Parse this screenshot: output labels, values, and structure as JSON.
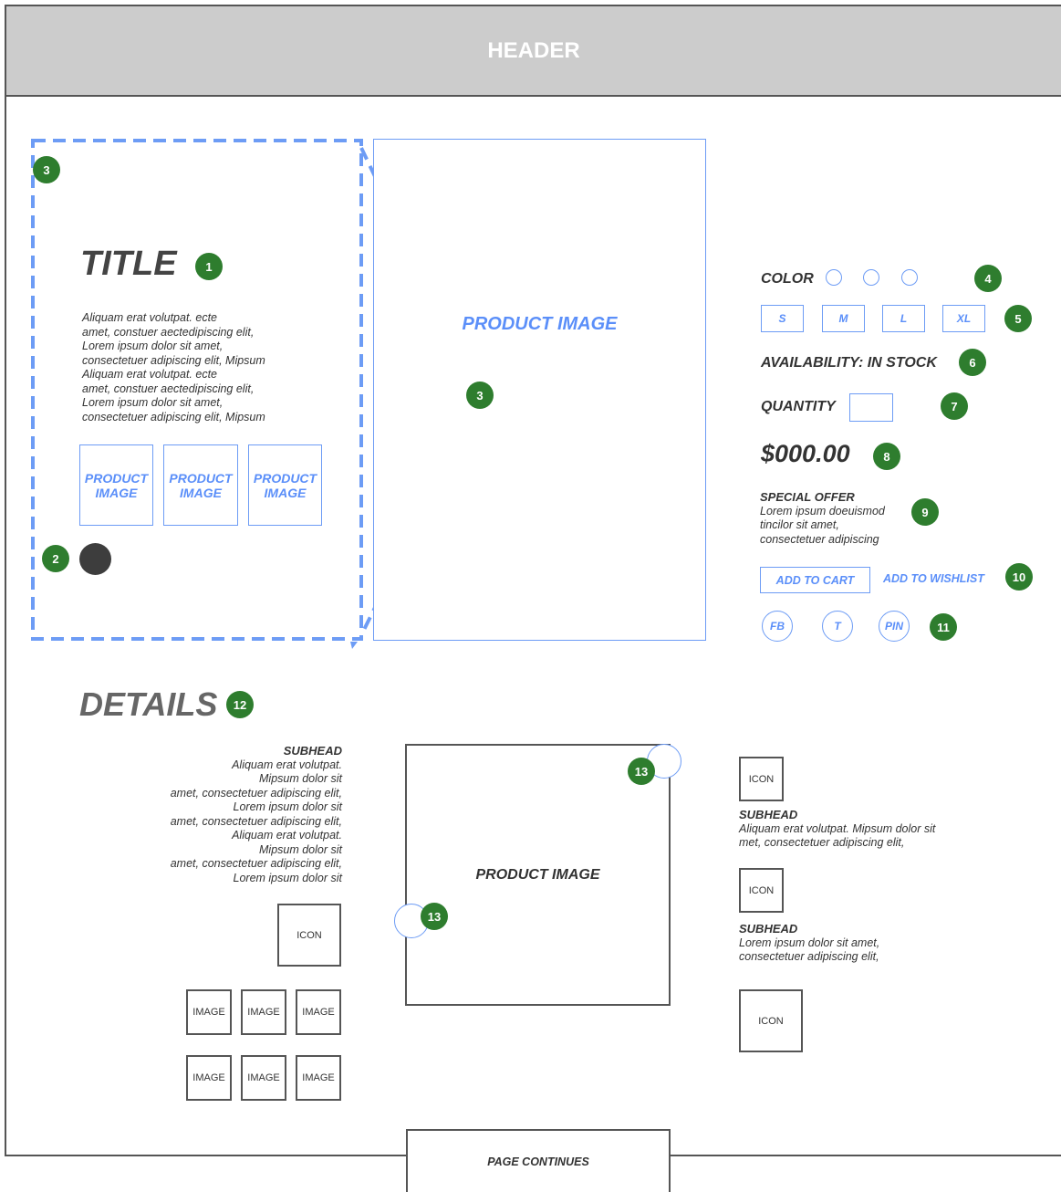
{
  "header": {
    "label": "HEADER"
  },
  "product": {
    "title": "TITLE",
    "description": [
      "Aliquam erat volutpat. ecte",
      "amet, constuer aectedipiscing elit,",
      "Lorem ipsum dolor sit amet,",
      "consectetuer adipiscing elit, Mipsum",
      "Aliquam erat volutpat. ecte",
      "amet, constuer aectedipiscing elit,",
      "Lorem ipsum dolor sit amet,",
      "consectetuer adipiscing elit, Mipsum"
    ],
    "thumbnails": [
      "PRODUCT IMAGE",
      "PRODUCT IMAGE",
      "PRODUCT IMAGE"
    ],
    "main_image": "PRODUCT IMAGE"
  },
  "options": {
    "color_label": "COLOR",
    "sizes": [
      "S",
      "M",
      "L",
      "XL"
    ],
    "availability": "AVAILABILITY: IN STOCK",
    "quantity_label": "QUANTITY",
    "price": "$000.00",
    "special_offer_title": "SPECIAL OFFER",
    "special_offer_text": [
      "Lorem ipsum doeuismod",
      "tincilor sit amet,",
      "consectetuer adipiscing"
    ],
    "add_to_cart": "ADD TO CART",
    "add_to_wishlist": "ADD TO WISHLIST",
    "social": [
      "FB",
      "T",
      "PIN"
    ]
  },
  "details": {
    "title": "DETAILS",
    "left_subhead": "SUBHEAD",
    "left_text": [
      "Aliquam erat volutpat.",
      "Mipsum dolor sit",
      "amet, consectetuer adipiscing elit,",
      "Lorem ipsum dolor sit",
      "amet, consectetuer adipiscing elit,",
      "Aliquam erat volutpat.",
      "Mipsum dolor sit",
      "amet, consectetuer adipiscing elit,",
      "Lorem ipsum dolor sit"
    ],
    "icon_label": "ICON",
    "image_label": "IMAGE",
    "center_image": "PRODUCT IMAGE",
    "right_items": [
      {
        "icon": "ICON",
        "subhead": "SUBHEAD",
        "text": [
          "Aliquam erat volutpat. Mipsum dolor sit",
          "met, consectetuer adipiscing elit,"
        ]
      },
      {
        "icon": "ICON",
        "subhead": "SUBHEAD",
        "text": [
          "Lorem ipsum dolor sit amet,",
          "consectetuer adipiscing elit,"
        ]
      },
      {
        "icon": "ICON"
      }
    ]
  },
  "footer": {
    "label": "PAGE CONTINUES"
  },
  "badges": [
    "1",
    "2",
    "3",
    "4",
    "5",
    "6",
    "7",
    "8",
    "9",
    "10",
    "11",
    "12",
    "13"
  ],
  "colors": {
    "accent": "#5b8ff9",
    "badge": "#2e7d2e",
    "header_bg": "#cccccc"
  }
}
